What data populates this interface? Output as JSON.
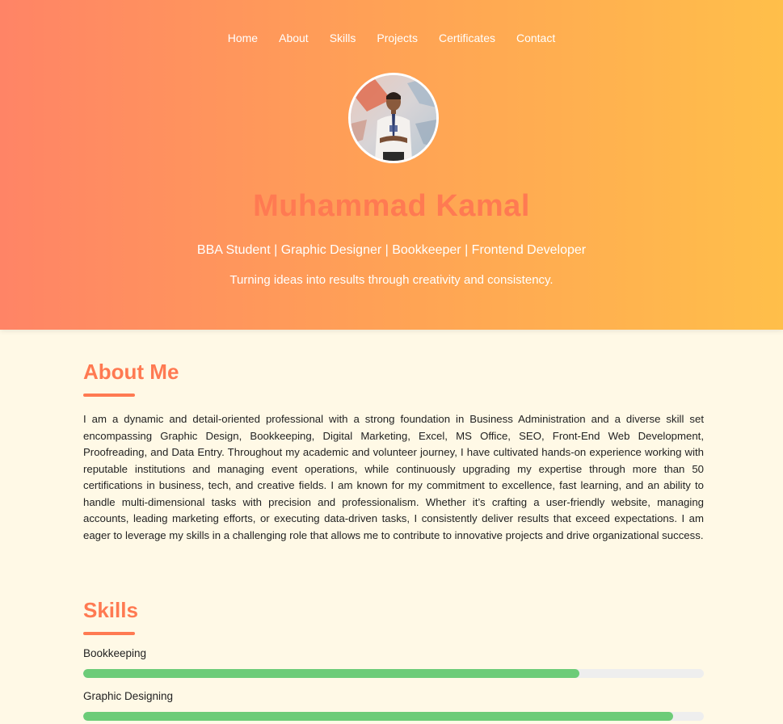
{
  "nav": {
    "items": [
      {
        "label": "Home"
      },
      {
        "label": "About"
      },
      {
        "label": "Skills"
      },
      {
        "label": "Projects"
      },
      {
        "label": "Certificates"
      },
      {
        "label": "Contact"
      }
    ]
  },
  "hero": {
    "name": "Muhammad Kamal",
    "roles": "BBA Student | Graphic Designer | Bookkeeper | Frontend Developer",
    "tagline": "Turning ideas into results through creativity and consistency.",
    "avatar_alt": "profile-photo"
  },
  "about": {
    "title": "About Me",
    "text": "I am a dynamic and detail-oriented professional with a strong foundation in Business Administration and a diverse skill set encompassing Graphic Design, Bookkeeping, Digital Marketing, Excel, MS Office, SEO, Front-End Web Development, Proofreading, and Data Entry. Throughout my academic and volunteer journey, I have cultivated hands-on experience working with reputable institutions and managing event operations, while continuously upgrading my expertise through more than 50 certifications in business, tech, and creative fields. I am known for my commitment to excellence, fast learning, and an ability to handle multi-dimensional tasks with precision and professionalism. Whether it’s crafting a user-friendly website, managing accounts, leading marketing efforts, or executing data-driven tasks, I consistently deliver results that exceed expectations. I am eager to leverage my skills in a challenging role that allows me to contribute to innovative projects and drive organizational success."
  },
  "skills": {
    "title": "Skills",
    "items": [
      {
        "label": "Bookkeeping",
        "percent": 80
      },
      {
        "label": "Graphic Designing",
        "percent": 95
      }
    ]
  },
  "colors": {
    "accent": "#ff7a52",
    "progress": "#6ccc78",
    "background": "#fff9e6"
  }
}
